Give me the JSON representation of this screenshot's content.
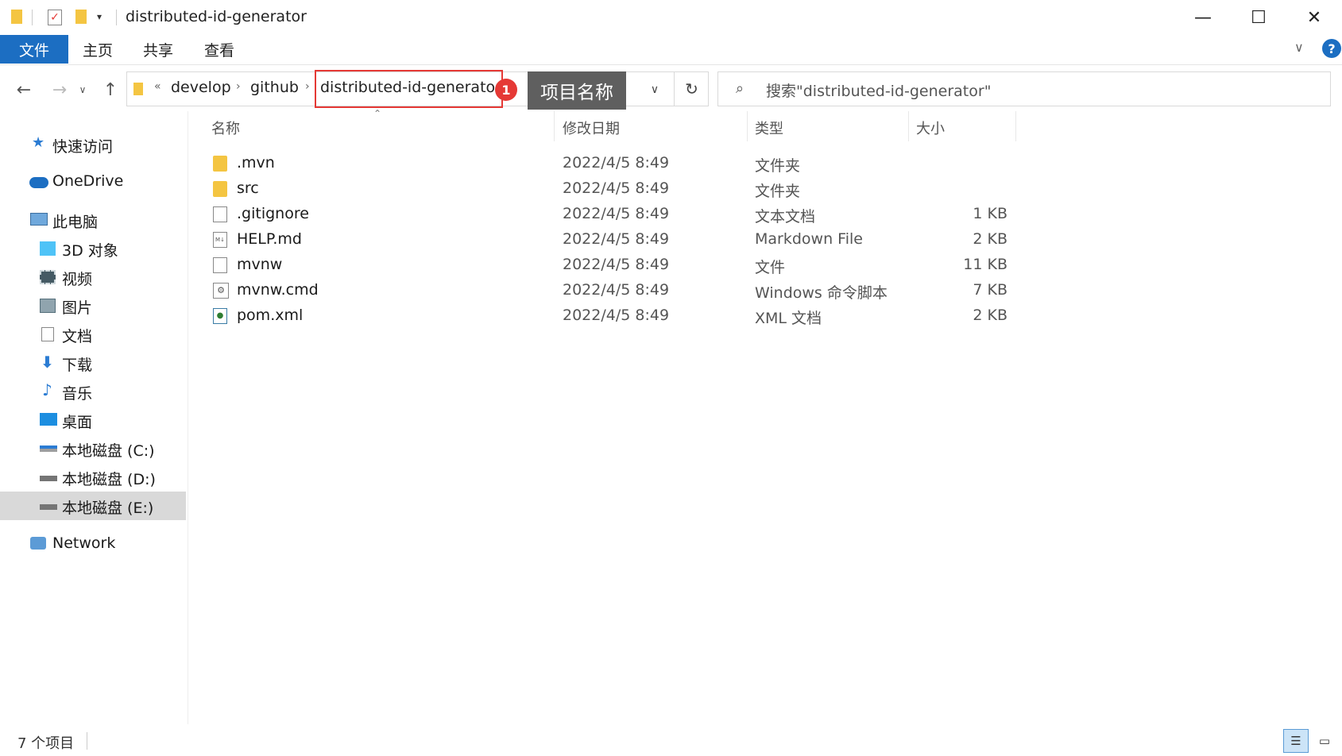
{
  "window": {
    "title": "distributed-id-generator",
    "minimize": "—",
    "maximize": "☐",
    "close": "✕"
  },
  "ribbon": {
    "tabs": [
      "文件",
      "主页",
      "共享",
      "查看"
    ],
    "help": "?"
  },
  "address": {
    "overflow": "«",
    "crumbs": [
      "develop",
      "github",
      "distributed-id-generator"
    ],
    "annotation_badge": "1",
    "annotation_label": "项目名称"
  },
  "search": {
    "placeholder": "搜索\"distributed-id-generator\""
  },
  "sidebar": {
    "items": [
      {
        "label": "快速访问",
        "icon": "star-icon"
      },
      {
        "label": "OneDrive",
        "icon": "cloud-icon"
      },
      {
        "label": "此电脑",
        "icon": "computer-icon"
      },
      {
        "label": "3D 对象",
        "icon": "cube-icon"
      },
      {
        "label": "视频",
        "icon": "video-icon"
      },
      {
        "label": "图片",
        "icon": "picture-icon"
      },
      {
        "label": "文档",
        "icon": "document-icon"
      },
      {
        "label": "下载",
        "icon": "download-icon"
      },
      {
        "label": "音乐",
        "icon": "music-icon"
      },
      {
        "label": "桌面",
        "icon": "desktop-icon"
      },
      {
        "label": "本地磁盘 (C:)",
        "icon": "drive-icon"
      },
      {
        "label": "本地磁盘 (D:)",
        "icon": "drive-icon"
      },
      {
        "label": "本地磁盘 (E:)",
        "icon": "drive-icon"
      },
      {
        "label": "Network",
        "icon": "network-icon"
      }
    ]
  },
  "columns": {
    "name": "名称",
    "modified": "修改日期",
    "type": "类型",
    "size": "大小"
  },
  "files": [
    {
      "name": ".mvn",
      "modified": "2022/4/5 8:49",
      "type": "文件夹",
      "size": "",
      "icon": "folder-icon"
    },
    {
      "name": "src",
      "modified": "2022/4/5 8:49",
      "type": "文件夹",
      "size": "",
      "icon": "folder-icon"
    },
    {
      "name": ".gitignore",
      "modified": "2022/4/5 8:49",
      "type": "文本文档",
      "size": "1 KB",
      "icon": "text-file-icon"
    },
    {
      "name": "HELP.md",
      "modified": "2022/4/5 8:49",
      "type": "Markdown File",
      "size": "2 KB",
      "icon": "markdown-file-icon"
    },
    {
      "name": "mvnw",
      "modified": "2022/4/5 8:49",
      "type": "文件",
      "size": "11 KB",
      "icon": "file-icon"
    },
    {
      "name": "mvnw.cmd",
      "modified": "2022/4/5 8:49",
      "type": "Windows 命令脚本",
      "size": "7 KB",
      "icon": "script-file-icon"
    },
    {
      "name": "pom.xml",
      "modified": "2022/4/5 8:49",
      "type": "XML 文档",
      "size": "2 KB",
      "icon": "xml-file-icon"
    }
  ],
  "status": {
    "count": "7 个项目"
  },
  "colors": {
    "accent": "#1c6ec2",
    "highlight": "#e53935",
    "callout": "#5f5f5f",
    "selected_nav": "#d9d9d9"
  }
}
